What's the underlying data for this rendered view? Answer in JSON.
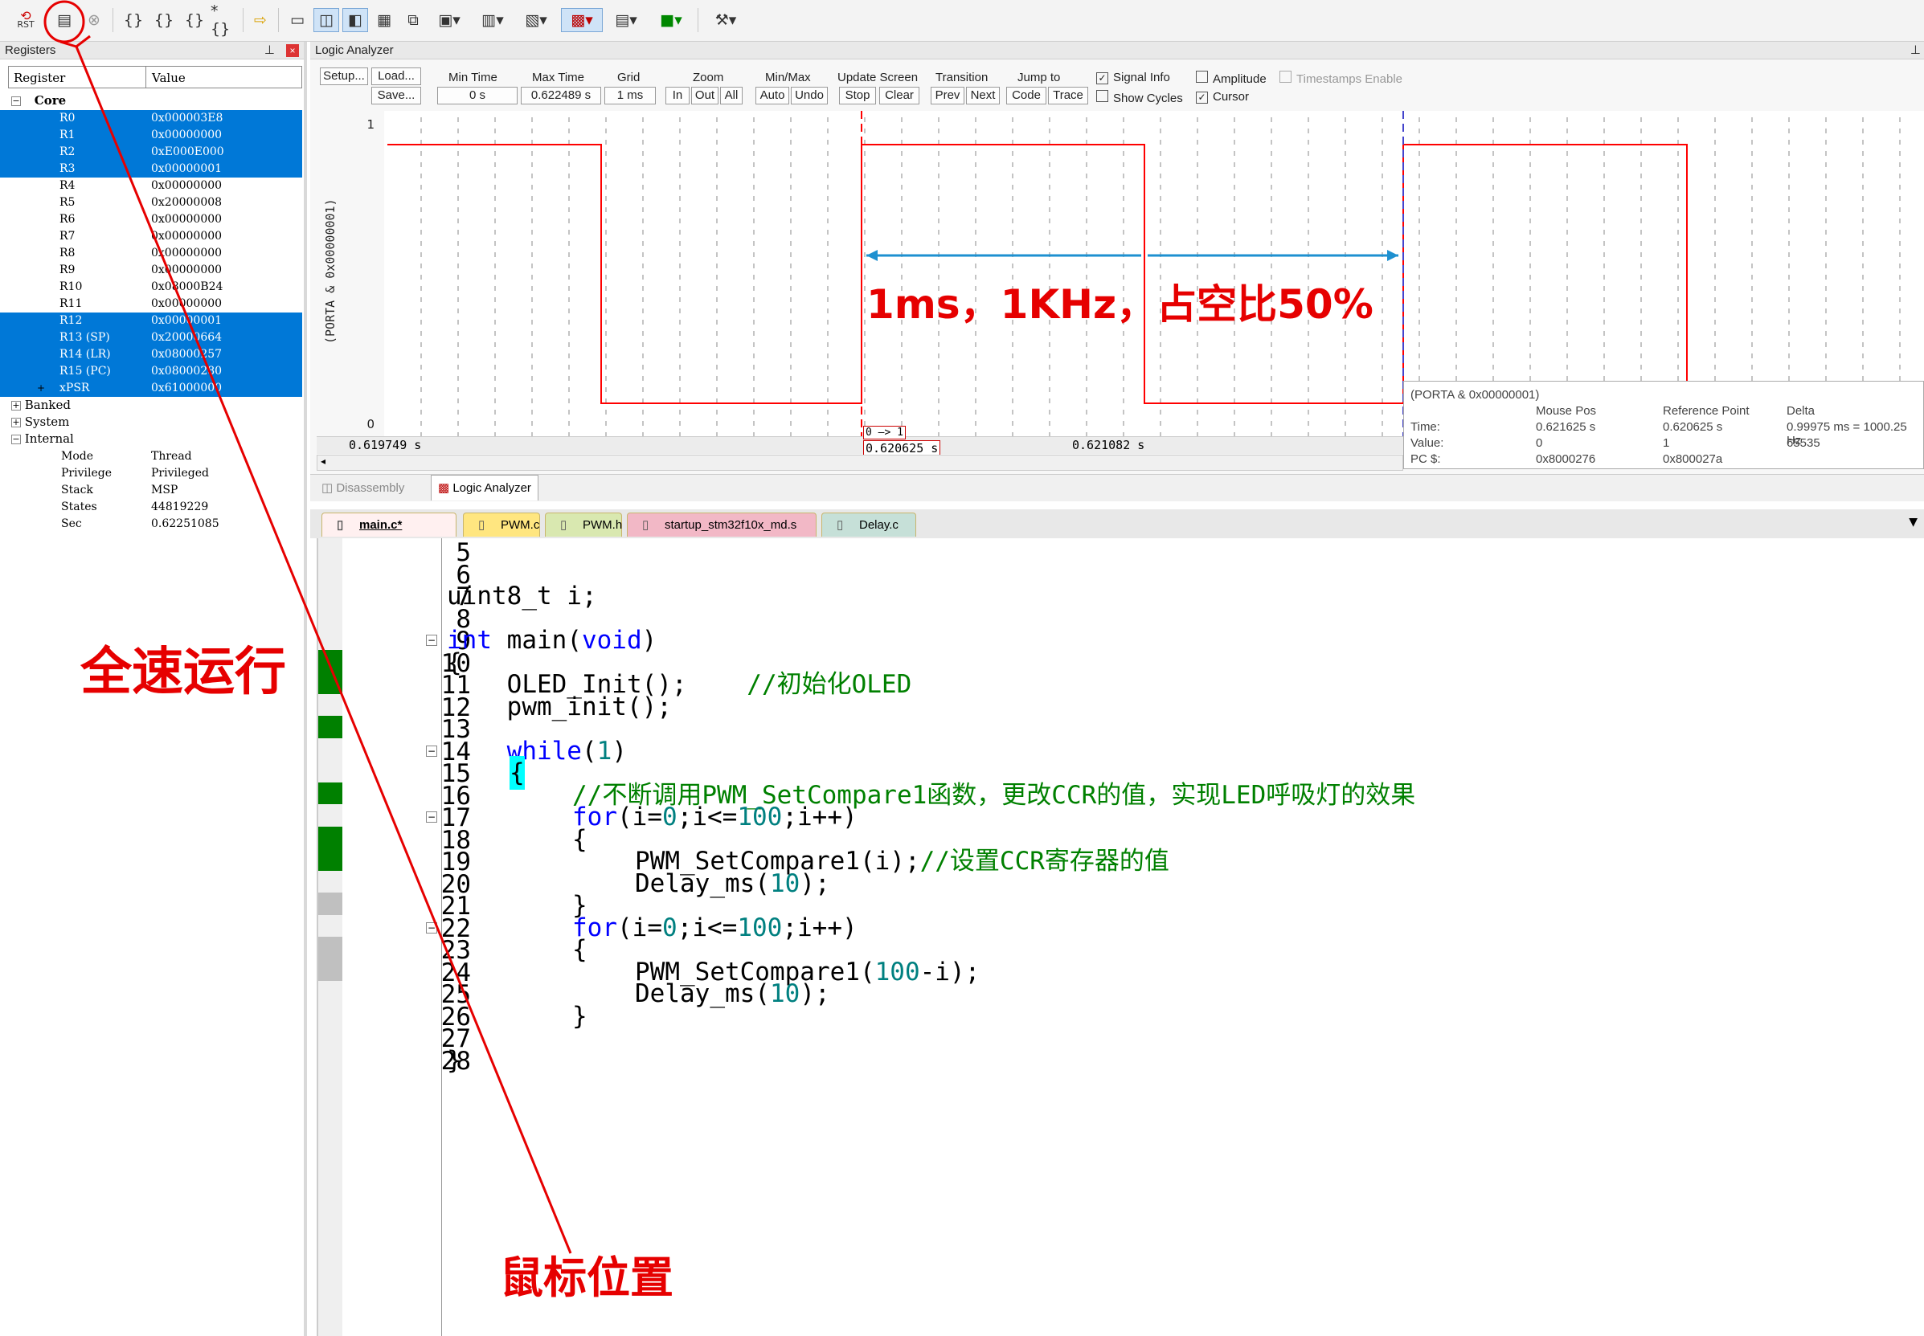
{
  "toolbar": {
    "rst": "RST",
    "icons": [
      "reset-icon",
      "run-icon",
      "stop-icon",
      "step-into-icon",
      "step-over-icon",
      "step-out-icon",
      "run-to-cursor-icon",
      "show-next-statement-icon",
      "command-window-icon",
      "disassembly-window-icon",
      "symbols-window-icon",
      "registers-window-icon",
      "call-stack-icon",
      "watch-window-icon",
      "memory-window-icon",
      "serial-window-icon",
      "analysis-window-icon",
      "trace-window-icon",
      "system-viewer-icon",
      "toolbox-icon"
    ]
  },
  "registers": {
    "title": "Registers",
    "col_register": "Register",
    "col_value": "Value",
    "core_label": "Core",
    "rows": [
      {
        "name": "R0",
        "value": "0x000003E8",
        "sel": true
      },
      {
        "name": "R1",
        "value": "0x00000000",
        "sel": true
      },
      {
        "name": "R2",
        "value": "0xE000E000",
        "sel": true
      },
      {
        "name": "R3",
        "value": "0x00000001",
        "sel": true
      },
      {
        "name": "R4",
        "value": "0x00000000",
        "sel": false
      },
      {
        "name": "R5",
        "value": "0x20000008",
        "sel": false
      },
      {
        "name": "R6",
        "value": "0x00000000",
        "sel": false
      },
      {
        "name": "R7",
        "value": "0x00000000",
        "sel": false
      },
      {
        "name": "R8",
        "value": "0x00000000",
        "sel": false
      },
      {
        "name": "R9",
        "value": "0x00000000",
        "sel": false
      },
      {
        "name": "R10",
        "value": "0x08000B24",
        "sel": false
      },
      {
        "name": "R11",
        "value": "0x00000000",
        "sel": false
      },
      {
        "name": "R12",
        "value": "0x00000001",
        "sel": true
      },
      {
        "name": "R13 (SP)",
        "value": "0x20000664",
        "sel": true
      },
      {
        "name": "R14 (LR)",
        "value": "0x08000257",
        "sel": true
      },
      {
        "name": "R15 (PC)",
        "value": "0x08000280",
        "sel": true
      },
      {
        "name": "xPSR",
        "value": "0x61000000",
        "sel": true
      }
    ],
    "groups": [
      "Banked",
      "System",
      "Internal"
    ],
    "internal": [
      {
        "name": "Mode",
        "value": "Thread"
      },
      {
        "name": "Privilege",
        "value": "Privileged"
      },
      {
        "name": "Stack",
        "value": "MSP"
      },
      {
        "name": "States",
        "value": "44819229"
      },
      {
        "name": "Sec",
        "value": "0.62251085"
      }
    ]
  },
  "la": {
    "title": "Logic Analyzer",
    "setup": "Setup...",
    "load": "Load...",
    "save": "Save...",
    "min_time_label": "Min Time",
    "min_time": "0 s",
    "max_time_label": "Max Time",
    "max_time": "0.622489 s",
    "grid_label": "Grid",
    "grid": "1 ms",
    "zoom_label": "Zoom",
    "zoom_in": "In",
    "zoom_out": "Out",
    "zoom_all": "All",
    "minmax_label": "Min/Max",
    "auto": "Auto",
    "undo": "Undo",
    "update_label": "Update Screen",
    "stop": "Stop",
    "clear": "Clear",
    "transition_label": "Transition",
    "prev": "Prev",
    "next": "Next",
    "jump_label": "Jump to",
    "code": "Code",
    "trace": "Trace",
    "signal_info": "Signal Info",
    "show_cycles": "Show Cycles",
    "amplitude": "Amplitude",
    "cursor": "Cursor",
    "timestamps": "Timestamps Enable",
    "signal_name": "(PORTA & 0x00000001)",
    "y_high": "1",
    "y_low": "0",
    "t_left": "0.619749  s",
    "t_ref": "0.620625  s",
    "t_mid": "0.621082  s",
    "ref_marker": "0 —> 1",
    "info": {
      "signal": "(PORTA & 0x00000001)",
      "h_mouse": "Mouse Pos",
      "h_ref": "Reference Point",
      "h_delta": "Delta",
      "time_label": "Time:",
      "time_mouse": "0.621625 s",
      "time_ref": "0.620625 s",
      "time_delta": "0.99975 ms = 1000.25 Hz",
      "value_label": "Value:",
      "value_mouse": "0",
      "value_ref": "1",
      "value_delta": "65535",
      "pc_label": "PC $:",
      "pc_mouse": "0x8000276",
      "pc_ref": "0x800027a"
    }
  },
  "view_tabs": {
    "disassembly": "Disassembly",
    "logic": "Logic Analyzer"
  },
  "file_tabs": [
    {
      "name": "main.c*",
      "color": "#f4a7a7"
    },
    {
      "name": "PWM.c",
      "color": "#ffe680"
    },
    {
      "name": "PWM.h",
      "color": "#d9e8b0"
    },
    {
      "name": "startup_stm32f10x_md.s",
      "color": "#f2b8c6"
    },
    {
      "name": "Delay.c",
      "color": "#c6e0d8"
    }
  ],
  "code": {
    "lines": [
      "5",
      "6",
      "7",
      "8",
      "9",
      "10",
      "11",
      "12",
      "13",
      "14",
      "15",
      "16",
      "17",
      "18",
      "19",
      "20",
      "21",
      "22",
      "23",
      "24",
      "25",
      "26",
      "27",
      "28"
    ],
    "l6": "uint8_t i;",
    "l8a": "int",
    "l8b": " main(",
    "l8c": "void",
    "l8d": ")",
    "l9": "{",
    "l10a": "    OLED_Init();    ",
    "l10b": "//初始化OLED",
    "l11": "    pwm_init();",
    "l13a": "    ",
    "l13b": "while",
    "l13c": "(",
    "l13d": "1",
    "l13e": ")",
    "l14": "{",
    "l15": "//不断调用PWM_SetCompare1函数，更改CCR的值，实现LED呼吸灯的效果",
    "l16a": "for",
    "l16b": "(i=",
    "l16c": "0",
    "l16d": ";i<=",
    "l16e": "100",
    "l16f": ";i++)",
    "l17": "{",
    "l18a": "PWM_SetCompare1(i);",
    "l18b": "//设置CCR寄存器的值",
    "l19a": "Delay_ms(",
    "l19b": "10",
    "l19c": ");",
    "l20": "}",
    "l21a": "for",
    "l21b": "(i=",
    "l21c": "0",
    "l21d": ";i<=",
    "l21e": "100",
    "l21f": ";i++)",
    "l22": "{",
    "l23a": "PWM_SetCompare1(",
    "l23b": "100",
    "l23c": "-i);",
    "l24a": "Delay_ms(",
    "l24b": "10",
    "l24c": ");",
    "l25": "}",
    "l27": "}"
  },
  "annotations": {
    "run": "全速运行",
    "measure": "1ms，1KHz，占空比50%",
    "mouse": "鼠标位置"
  },
  "colors": {
    "selection": "#0078d7",
    "waveform": "#ff0000",
    "annotation": "#e60000",
    "measure_arrow": "#1e90d0",
    "exec_mark": "#008000",
    "noexec_mark": "#c0c0c0"
  }
}
